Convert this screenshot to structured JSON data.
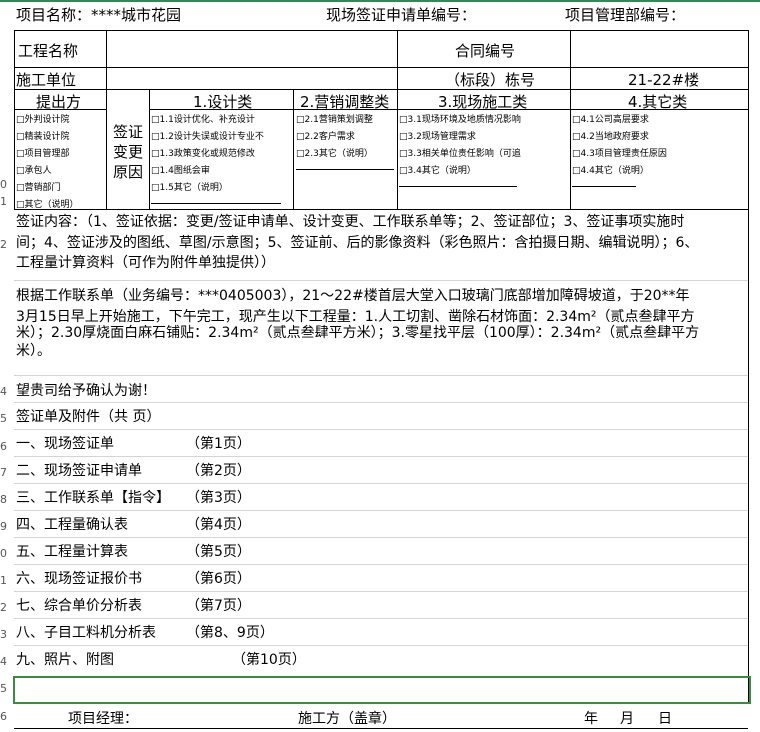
{
  "top": {
    "project_label": "项目名称：****城市花园",
    "request_no_label": "现场签证申请单编号：",
    "dept_no_label": "项目管理部编号："
  },
  "row1": {
    "project_name_label": "工程名称",
    "contract_no_label": "合同编号"
  },
  "row2": {
    "contractor_label": "施工单位",
    "building_label": "（标段）栋号",
    "building_value": "21-22#楼"
  },
  "headers": {
    "proposer": "提出方",
    "reason": "签证变更原因",
    "cat1": "1.设计类",
    "cat2": "2.营销调整类",
    "cat3": "3.现场施工类",
    "cat4": "4.其它类"
  },
  "proposers": [
    "□外判设计院",
    "□精装设计院",
    "□项目管理部",
    "□承包人",
    "□营销部门",
    "□其它（说明）"
  ],
  "cat1_items": [
    "□1.1设计优化、补充设计",
    "□1.2设计失误或设计专业不",
    "□1.3政策变化或规范修改",
    "□1.4图纸会审",
    "□1.5其它（说明）"
  ],
  "cat2_items": [
    "□2.1营销策划调整",
    "□2.2客户需求",
    "□2.3其它（说明）"
  ],
  "cat3_items": [
    "□3.1现场环境及地质情况影响",
    "□3.2现场管理需求",
    "□3.3相关单位责任影响（可追",
    "□3.4其它（说明）"
  ],
  "cat4_items": [
    "□4.1公司高层要求",
    "□4.2当地政府要求",
    "□4.3项目管理责任原因",
    "□4.4其它（说明）"
  ],
  "content": {
    "line1": "签证内容：（1、签证依据：变更/签证申请单、设计变更、工作联系单等；2、签证部位；3、签证事项实施时",
    "line2": "间；4、签证涉及的图纸、草图/示意图；5、签证前、后的影像资料（彩色照片：含拍摄日期、编辑说明）；6、",
    "line3": "工程量计算资料（可作为附件单独提供））"
  },
  "body": {
    "line1": "    根据工作联系单（业务编号：***0405003），21～22#楼首层大堂入口玻璃门底部增加障碍坡道，于20**年",
    "line2": "3月15日早上开始施工，下午完工，现产生以下工程量：1.人工切割、凿除石材饰面：2.34m²（贰点叁肆平方",
    "line3": "米）；2.30厚烧面白麻石铺贴：2.34m²（贰点叁肆平方米）；3.零星找平层（100厚）：2.34m²（贰点叁肆平方",
    "line4": "米）。"
  },
  "thanks": "望贵司给予确认为谢！",
  "attach_title": "签证单及附件（共  页）",
  "attachments": [
    {
      "name": "一、现场签证单",
      "page": "（第1页）"
    },
    {
      "name": "二、现场签证申请单",
      "page": "（第2页）"
    },
    {
      "name": "三、工作联系单【指令】",
      "page": "（第3页）"
    },
    {
      "name": "四、工程量确认表",
      "page": "（第4页）"
    },
    {
      "name": "五、工程量计算表",
      "page": "（第5页）"
    },
    {
      "name": "六、现场签证报价书",
      "page": "（第6页）"
    },
    {
      "name": "七、综合单价分析表",
      "page": "（第7页）"
    },
    {
      "name": "八、子目工料机分析表",
      "page": "（第8、9页）"
    },
    {
      "name": "九、照片、附图",
      "page": "（第10页）"
    }
  ],
  "footer": {
    "manager": "项目经理：",
    "contractor_seal": "施工方（盖章）",
    "year": "年",
    "month": "月",
    "day": "日"
  },
  "rownums": [
    "0",
    "1",
    "2",
    "4",
    "5",
    "6",
    "7",
    "8",
    "9",
    "0",
    "1",
    "2",
    "3",
    "4",
    "5",
    "6"
  ]
}
